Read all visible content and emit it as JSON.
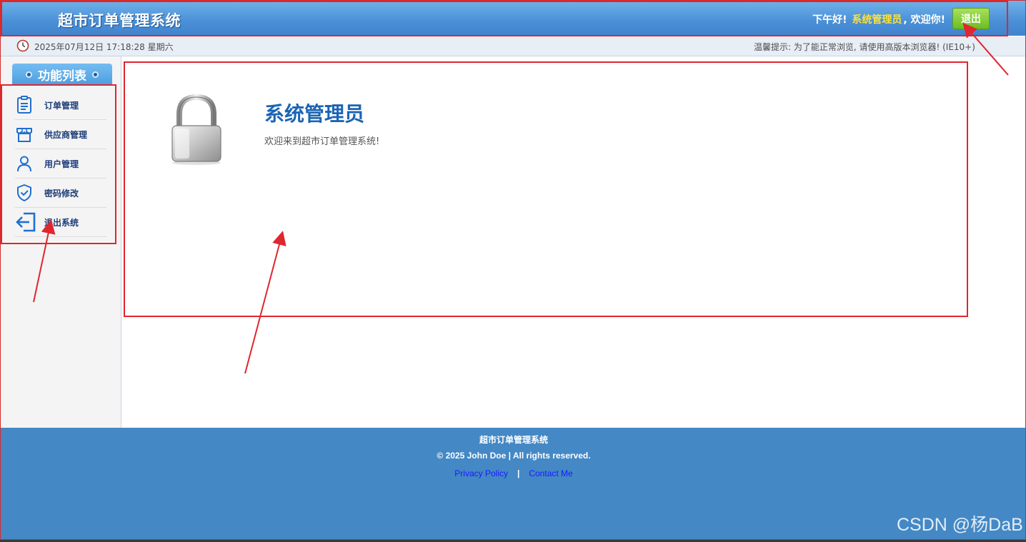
{
  "header": {
    "title": "超市订单管理系统",
    "greeting_prefix": "下午好!",
    "user_name": "系统管理员",
    "greeting_suffix": ", 欢迎你!",
    "logout_label": "退出"
  },
  "infobar": {
    "datetime": "2025年07月12日 17:18:28 星期六",
    "tip": "温馨提示: 为了能正常浏览, 请使用高版本浏览器! (IE10+)"
  },
  "sidebar": {
    "heading": "功能列表",
    "items": [
      {
        "label": "订单管理",
        "icon": "clipboard-icon"
      },
      {
        "label": "供应商管理",
        "icon": "store-icon"
      },
      {
        "label": "用户管理",
        "icon": "user-icon"
      },
      {
        "label": "密码修改",
        "icon": "shield-check-icon"
      },
      {
        "label": "退出系统",
        "icon": "exit-icon"
      }
    ]
  },
  "main": {
    "title": "系统管理员",
    "subtitle": "欢迎来到超市订单管理系统!",
    "icon": "padlock-icon"
  },
  "footer": {
    "name": "超市订单管理系统",
    "copyright": "© 2025 John Doe | All rights reserved.",
    "links": [
      {
        "label": "Privacy Policy"
      },
      {
        "label": "Contact Me"
      }
    ],
    "separator": "|",
    "watermark": "CSDN @杨DaB"
  },
  "colors": {
    "header_blue": "#4a8fd6",
    "footer_blue": "#4488c5",
    "highlight_red": "#e0262e",
    "user_name_yellow": "#ffe233",
    "logout_green": "#6cbe22",
    "title_blue": "#1b64b4"
  }
}
